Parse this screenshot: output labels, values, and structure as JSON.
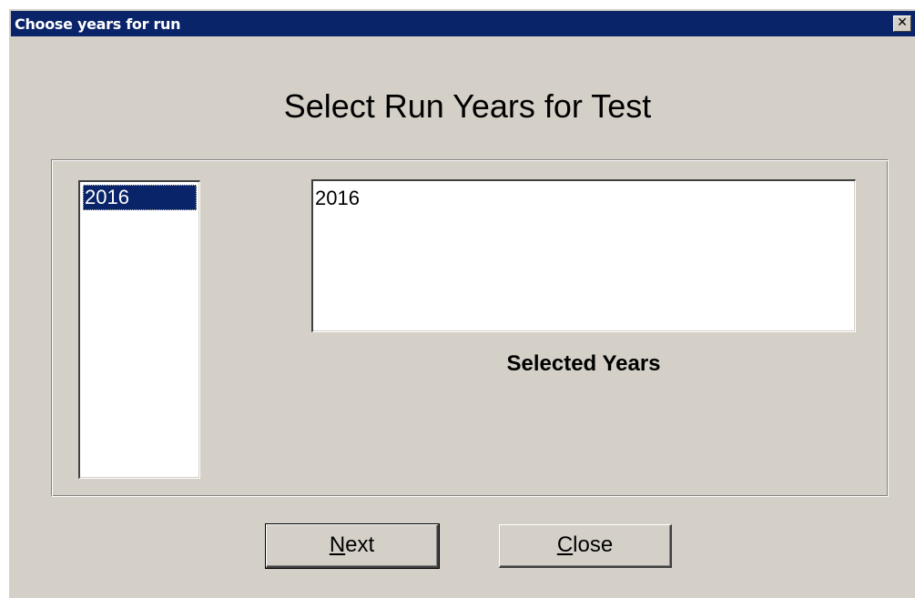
{
  "window": {
    "title": "Choose years for run",
    "close_glyph": "✕"
  },
  "heading": "Select Run Years for Test",
  "available_years": {
    "items": [
      "2016"
    ],
    "selected_index": 0
  },
  "selected_years": {
    "value": "2016",
    "label": "Selected Years"
  },
  "buttons": {
    "next": {
      "accel": "N",
      "rest": "ext"
    },
    "close": {
      "accel": "C",
      "rest": "lose"
    }
  },
  "colors": {
    "titlebar": "#0a246a",
    "face": "#d4d0c8",
    "selection": "#0a246a"
  }
}
